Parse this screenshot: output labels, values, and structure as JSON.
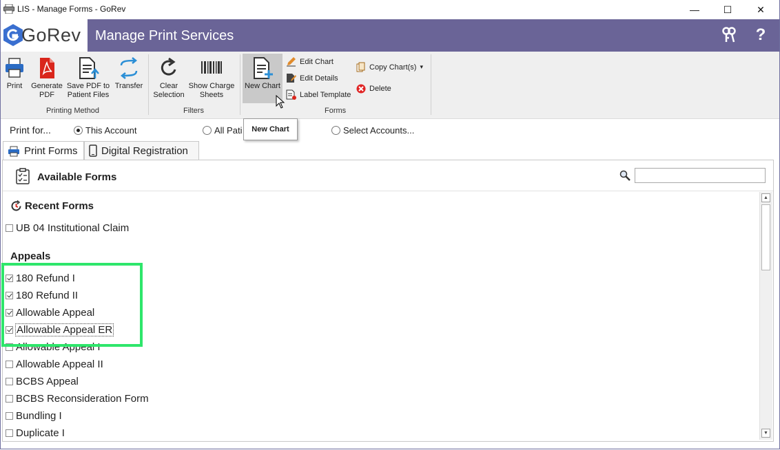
{
  "window": {
    "title": "LIS - Manage Forms - GoRev",
    "minimize_glyph": "—",
    "maximize_glyph": "☐",
    "close_glyph": "✕"
  },
  "header": {
    "logo_text": "GoRev",
    "title": "Manage Print Services",
    "keys_glyph": "⚷",
    "help_glyph": "?"
  },
  "ribbon": {
    "groups": {
      "printing_method": "Printing Method",
      "filters": "Filters",
      "forms": "Forms"
    },
    "print": "Print",
    "generate_pdf": "Generate PDF",
    "save_pdf": "Save PDF to Patient Files",
    "transfer": "Transfer",
    "clear_selection": "Clear Selection",
    "show_charge_sheets": "Show Charge Sheets",
    "new_chart": "New Chart",
    "edit_chart": "Edit Chart",
    "edit_details": "Edit Details",
    "label_template": "Label Template",
    "copy_charts": "Copy Chart(s)",
    "delete": "Delete"
  },
  "tooltip": "New Chart",
  "print_for": {
    "label": "Print for...",
    "options": [
      "This Account",
      "All Pati",
      "Select Accounts..."
    ],
    "selected": "This Account"
  },
  "tabs": [
    "Print Forms",
    "Digital Registration"
  ],
  "panel": {
    "title": "Available Forms",
    "search_value": "",
    "recent_title": "Recent Forms",
    "appeals_title": "Appeals",
    "recent": [
      {
        "label": "UB 04 Institutional Claim",
        "checked": false
      }
    ],
    "appeals": [
      {
        "label": "180 Refund I",
        "checked": true
      },
      {
        "label": "180 Refund II",
        "checked": true
      },
      {
        "label": "Allowable Appeal",
        "checked": true
      },
      {
        "label": "Allowable Appeal ER",
        "checked": true
      },
      {
        "label": "Allowable Appeal I",
        "checked": false
      },
      {
        "label": "Allowable Appeal II",
        "checked": false
      },
      {
        "label": "BCBS Appeal",
        "checked": false
      },
      {
        "label": "BCBS Reconsideration Form",
        "checked": false
      },
      {
        "label": "Bundling I",
        "checked": false
      },
      {
        "label": "Duplicate I",
        "checked": false
      }
    ]
  },
  "colors": {
    "header_bg": "#6a6497",
    "highlight_box": "#2ee66b",
    "ribbon_bg": "#efefef"
  }
}
